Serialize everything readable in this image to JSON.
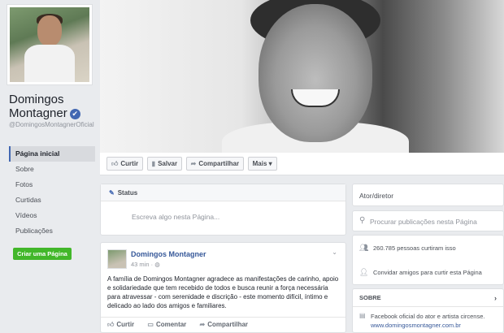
{
  "profile": {
    "name_line1": "Domingos",
    "name_line2": "Montagner",
    "verified_icon": "✔",
    "handle": "@DomingosMontagnerOficial"
  },
  "nav": {
    "items": [
      {
        "label": "Página inicial",
        "active": true
      },
      {
        "label": "Sobre"
      },
      {
        "label": "Fotos"
      },
      {
        "label": "Curtidas"
      },
      {
        "label": "Vídeos"
      },
      {
        "label": "Publicações"
      }
    ],
    "create_page": "Criar uma Página"
  },
  "actions": {
    "like": "Curtir",
    "save": "Salvar",
    "share": "Compartilhar",
    "more": "Mais"
  },
  "status": {
    "title": "Status",
    "placeholder": "Escreva algo nesta Página..."
  },
  "post": {
    "author": "Domingos Montagner",
    "time": "43 min",
    "text": "A família de Domingos Montagner agradece as manifestações de carinho, apoio e solidariedade que tem recebido de todos e busca reunir a força necessária para atravessar - com serenidade e discrição - este momento difícil, íntimo e delicado ao lado dos amigos e familiares.",
    "like": "Curtir",
    "comment": "Comentar",
    "share": "Compartilhar"
  },
  "sidebar": {
    "category": "Ator/diretor",
    "search_placeholder": "Procurar publicações nesta Página",
    "likes": "260.785 pessoas curtiram isso",
    "invite": "Convidar amigos para curtir esta Página",
    "about_title": "SOBRE",
    "about_desc": "Facebook oficial do ator e artista circense.",
    "about_link": "www.domingosmontagner.com.br"
  },
  "colors": {
    "accent": "#4267b2",
    "link": "#365899",
    "create_button": "#42b72a",
    "background": "#e9ebee"
  }
}
